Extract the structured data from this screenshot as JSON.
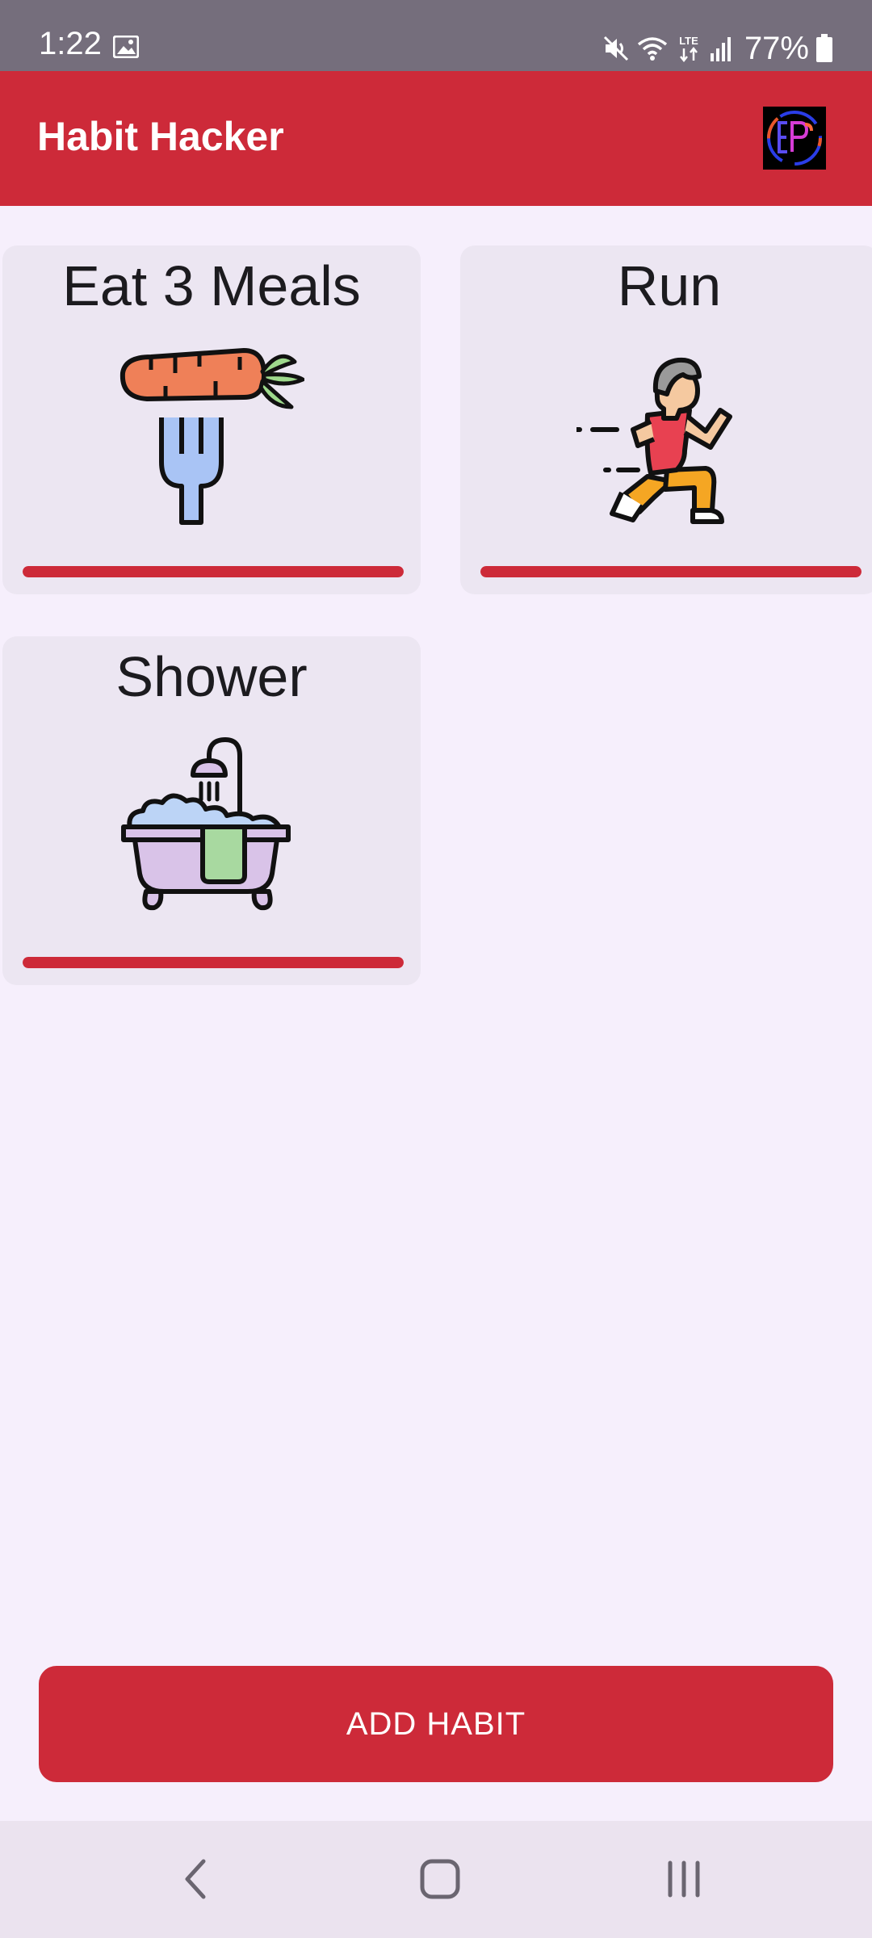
{
  "status_bar": {
    "time": "1:22",
    "battery": "77%",
    "network": "LTE",
    "icons": [
      "gallery-icon",
      "mute-icon",
      "wifi-icon",
      "lte-icon",
      "signal-icon",
      "battery-icon"
    ]
  },
  "app_bar": {
    "title": "Habit Hacker",
    "logo": "eps-logo"
  },
  "habits": [
    {
      "name": "Eat 3 Meals",
      "icon": "carrot-fork-icon",
      "progress": 1.0
    },
    {
      "name": "Run",
      "icon": "runner-icon",
      "progress": 1.0
    },
    {
      "name": "Shower",
      "icon": "bathtub-icon",
      "progress": 1.0
    }
  ],
  "add_button": {
    "label": "ADD HABIT"
  },
  "nav_bar": {
    "icons": [
      "back-icon",
      "home-icon",
      "recents-icon"
    ]
  },
  "colors": {
    "primary": "#cd2a39",
    "background": "#f6effc",
    "card": "#ece6f2",
    "status_bar": "#756e7c",
    "nav_bar": "#ebe3ef"
  }
}
